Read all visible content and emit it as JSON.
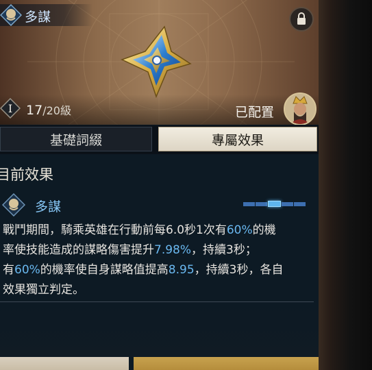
{
  "header": {
    "title": "多謀",
    "level_badge": "I",
    "level_current": "17",
    "level_max": "/20級",
    "assigned_label": "已配置"
  },
  "tabs": [
    {
      "label": "基礎詞綴",
      "active": false
    },
    {
      "label": "專屬效果",
      "active": true
    }
  ],
  "section": {
    "title": "目前效果"
  },
  "effect": {
    "name": "多謀",
    "pager": {
      "count": 5,
      "active_index": 2
    },
    "description_segments": [
      [
        {
          "t": "戰鬥期間，騎乘英雄在行動前每6.0秒1次有"
        },
        {
          "t": "60%",
          "hl": true
        },
        {
          "t": "的機"
        }
      ],
      [
        {
          "t": "率使技能造成的謀略傷害提升"
        },
        {
          "t": "7.98%",
          "hl": true
        },
        {
          "t": "，持續3秒；"
        }
      ],
      [
        {
          "t": "有"
        },
        {
          "t": "60%",
          "hl": true
        },
        {
          "t": "的機率使自身謀略值提高"
        },
        {
          "t": "8.95",
          "hl": true
        },
        {
          "t": "，持續3秒，各自"
        }
      ],
      [
        {
          "t": "效果獨立判定。"
        }
      ]
    ]
  },
  "colors": {
    "highlight": "#6ab8f0",
    "title_blue": "#86c6f5",
    "banner_bronze": "#a07e5c",
    "active_tab": "#f1ece0"
  },
  "icons": {
    "title": "brain-mask-icon",
    "lock": "lock-icon",
    "gem": "star-gem-icon",
    "avatar": "hero-avatar"
  }
}
